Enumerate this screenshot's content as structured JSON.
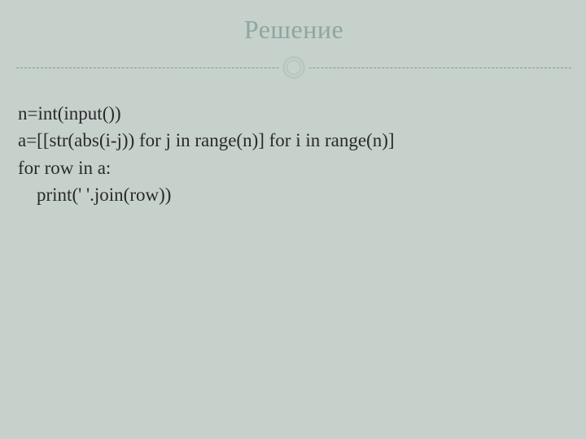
{
  "slide": {
    "title": "Решение",
    "code": {
      "line1": "n=int(input())",
      "line2": "a=[[str(abs(i-j)) for j in range(n)] for i in range(n)]",
      "line3": "for row in a:",
      "line4": "    print(' '.join(row))"
    }
  }
}
